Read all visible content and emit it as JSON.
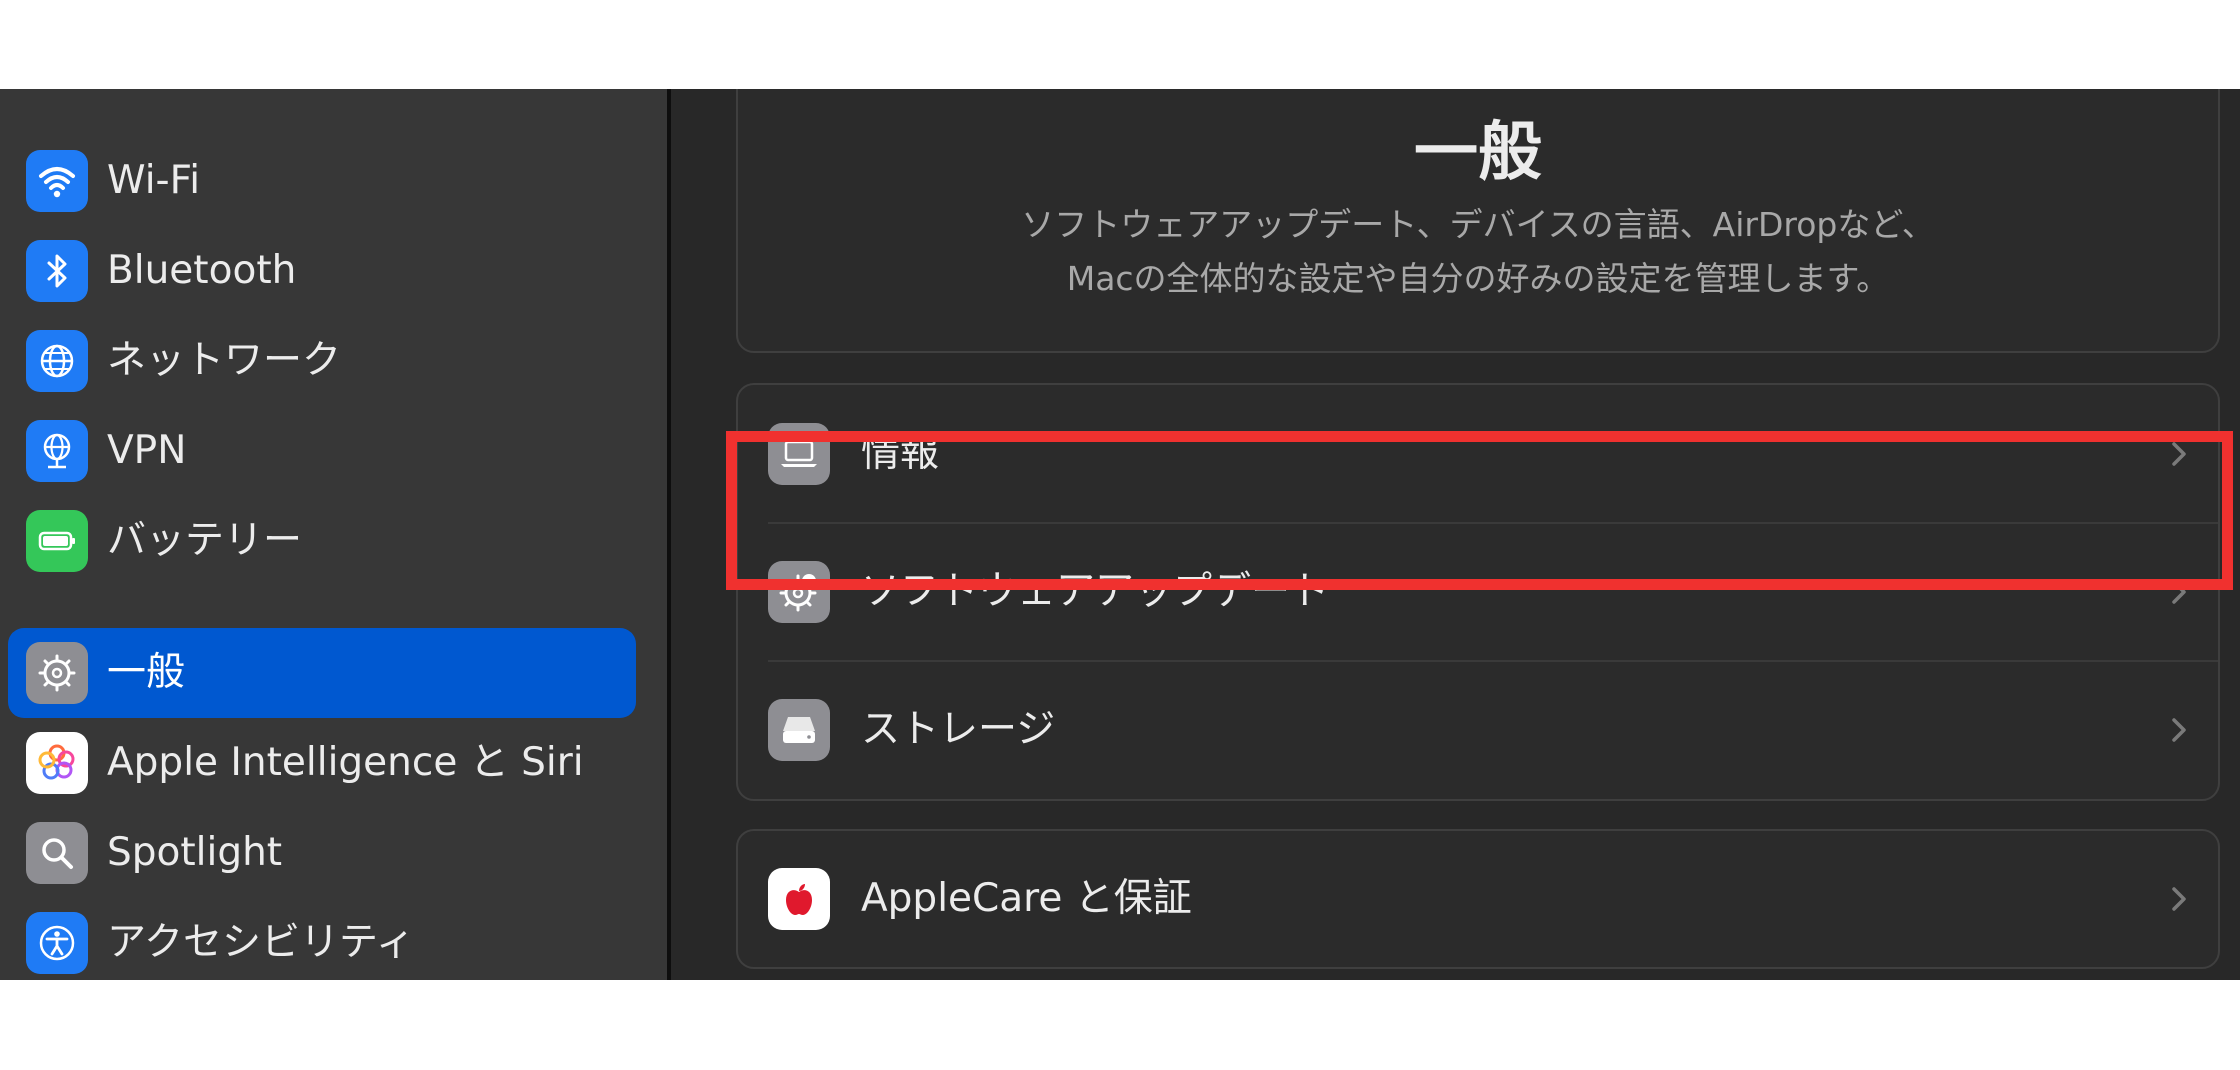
{
  "sidebar": {
    "items": [
      {
        "label": "Wi-Fi",
        "icon": "wifi-icon",
        "color": "#1f7bf5"
      },
      {
        "label": "Bluetooth",
        "icon": "bluetooth-icon",
        "color": "#1f7bf5"
      },
      {
        "label": "ネットワーク",
        "icon": "globe-icon",
        "color": "#1f7bf5"
      },
      {
        "label": "VPN",
        "icon": "vpn-globe-icon",
        "color": "#1f7bf5"
      },
      {
        "label": "バッテリー",
        "icon": "battery-icon",
        "color": "#34c759"
      },
      {
        "label": "一般",
        "icon": "gear-icon",
        "color": "#8e8e93",
        "selected": true
      },
      {
        "label": "Apple Intelligence と Siri",
        "icon": "apple-intelligence-icon",
        "color": "#ffffff"
      },
      {
        "label": "Spotlight",
        "icon": "magnifier-icon",
        "color": "#8e8e93"
      },
      {
        "label": "アクセシビリティ",
        "icon": "accessibility-icon",
        "color": "#1f7bf5"
      }
    ]
  },
  "main": {
    "title": "一般",
    "description_line1": "ソフトウェアアップデート、デバイスの言語、AirDropなど、",
    "description_line2": "Macの全体的な設定や自分の好みの設定を管理します。",
    "group1": [
      {
        "label": "情報",
        "icon": "laptop-icon"
      },
      {
        "label": "ソフトウェアアップデート",
        "icon": "gear-badge-icon"
      },
      {
        "label": "ストレージ",
        "icon": "drive-icon"
      }
    ],
    "group2": [
      {
        "label": "AppleCare と保証",
        "icon": "apple-logo-icon"
      }
    ]
  },
  "colors": {
    "selection": "#0058d0",
    "highlight_border": "#f0312f"
  }
}
